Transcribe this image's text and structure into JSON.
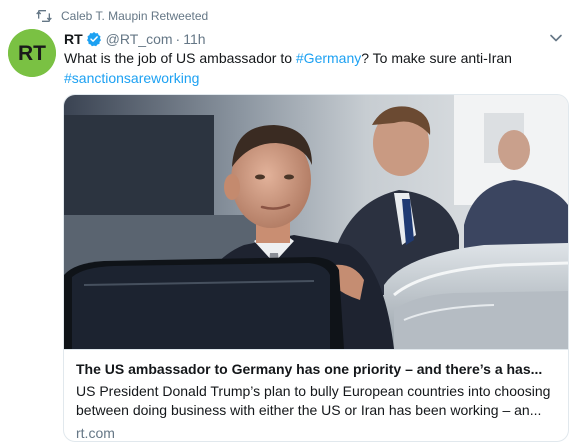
{
  "retweet": {
    "icon": "retweet-icon",
    "label": "Caleb T. Maupin Retweeted"
  },
  "author": {
    "avatar_text": "RT",
    "avatar_color": "#7ac143",
    "display_name": "RT",
    "verified_icon": "verified-badge-icon",
    "handle": "@RT_com",
    "separator": "·",
    "time": "11h"
  },
  "menu": {
    "icon": "chevron-down-icon"
  },
  "tweet": {
    "text_1": "What is the job of US ambassador to ",
    "hashtag_1": "#Germany",
    "text_2": "? To make sure anti-Iran ",
    "hashtag_2": "#sanctionsareworking",
    "hashtag_color": "#1da1f2"
  },
  "card": {
    "title": "The US ambassador to Germany has one priority – and there’s a has...",
    "description": "US President Donald Trump’s plan to bully European countries into choosing between doing business with either the US or Iran has been working – an...",
    "domain": "rt.com"
  }
}
